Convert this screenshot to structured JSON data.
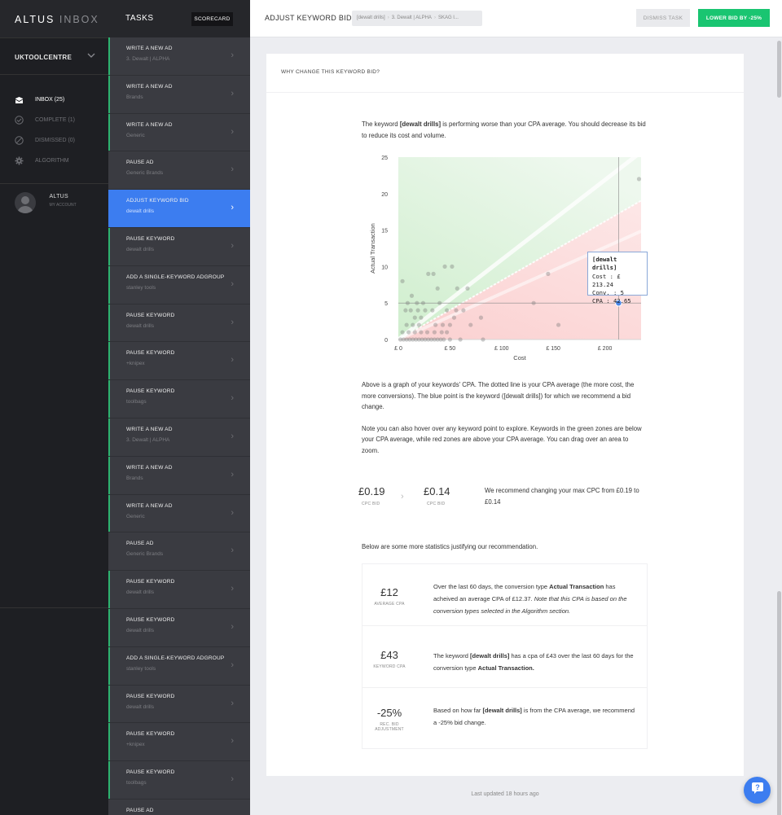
{
  "nav": {
    "logo_bold": "ALTUS",
    "logo_light": " INBOX",
    "account": "UKTOOLCENTRE",
    "menu": [
      {
        "label": "INBOX (25)",
        "icon": "inbox-icon",
        "active": true
      },
      {
        "label": "COMPLETE (1)",
        "icon": "check-circle-icon",
        "active": false
      },
      {
        "label": "DISMISSED (0)",
        "icon": "ban-icon",
        "active": false
      },
      {
        "label": "ALGORITHM",
        "icon": "gear-icon",
        "active": false
      }
    ],
    "user": {
      "name": "ALTUS",
      "sub": "MY ACCOUNT"
    }
  },
  "tasks_panel": {
    "title": "TASKS",
    "scorecard_label": "SCORECARD",
    "items": [
      {
        "title": "WRITE A NEW AD",
        "sub": "3. Dewalt | ALPHA",
        "accent": true
      },
      {
        "title": "WRITE A NEW AD",
        "sub": "Brands",
        "accent": true
      },
      {
        "title": "WRITE A NEW AD",
        "sub": "Generic",
        "accent": true
      },
      {
        "title": "PAUSE AD",
        "sub": "Generic Brands",
        "accent": false
      },
      {
        "title": "ADJUST KEYWORD BID",
        "sub": "dewalt drills",
        "accent": false,
        "active": true
      },
      {
        "title": "PAUSE KEYWORD",
        "sub": "dewalt drills",
        "accent": true
      },
      {
        "title": "ADD A SINGLE-KEYWORD ADGROUP",
        "sub": "stanley tools",
        "accent": true
      },
      {
        "title": "PAUSE KEYWORD",
        "sub": "dewalt drills",
        "accent": true
      },
      {
        "title": "PAUSE KEYWORD",
        "sub": "+knipex",
        "accent": true
      },
      {
        "title": "PAUSE KEYWORD",
        "sub": "toolbags",
        "accent": true
      },
      {
        "title": "WRITE A NEW AD",
        "sub": "3. Dewalt | ALPHA",
        "accent": true
      },
      {
        "title": "WRITE A NEW AD",
        "sub": "Brands",
        "accent": true
      },
      {
        "title": "WRITE A NEW AD",
        "sub": "Generic",
        "accent": true
      },
      {
        "title": "PAUSE AD",
        "sub": "Generic Brands",
        "accent": false
      },
      {
        "title": "PAUSE KEYWORD",
        "sub": "dewalt drills",
        "accent": true
      },
      {
        "title": "PAUSE KEYWORD",
        "sub": "dewalt drills",
        "accent": true
      },
      {
        "title": "ADD A SINGLE-KEYWORD ADGROUP",
        "sub": "stanley tools",
        "accent": true
      },
      {
        "title": "PAUSE KEYWORD",
        "sub": "dewalt drills",
        "accent": true
      },
      {
        "title": "PAUSE KEYWORD",
        "sub": "+knipex",
        "accent": true
      },
      {
        "title": "PAUSE KEYWORD",
        "sub": "toolbags",
        "accent": true
      },
      {
        "title": "PAUSE AD",
        "sub": "",
        "accent": false
      }
    ]
  },
  "header": {
    "title": "ADJUST KEYWORD BID",
    "breadcrumb": [
      "[dewalt drills]",
      "3. Dewalt | ALPHA",
      "SKAG I..."
    ],
    "dismiss_label": "DISMISS TASK",
    "action_label": "LOWER BID BY -25%"
  },
  "panel": {
    "heading": "WHY CHANGE THIS KEYWORD BID?",
    "intro_1": "The keyword ",
    "intro_keyword": "[dewalt drills]",
    "intro_2": " is performing worse than your CPA average. You should decrease its bid to reduce its cost and volume.",
    "explain_1": "Above is a graph of your keywords' CPA. The dotted line is your CPA average (the more cost, the more conversions). The blue point is the keyword ([dewalt drills]) for which we recommend a bid change.",
    "explain_2": "Note you can also hover over any keyword point to explore. Keywords in the green zones are below your CPA average, while red zones are above your CPA average. You can drag over an area to zoom.",
    "bid": {
      "current": "£0.19",
      "current_label": "CPC BID",
      "new": "£0.14",
      "new_label": "CPC BID",
      "text": "We recommend changing your max CPC from £0.19 to £0.14"
    },
    "stats_intro": "Below are some more statistics justifying our recommendation.",
    "stats": [
      {
        "value": "£12",
        "label": "AVERAGE CPA",
        "t1": "Over the last 60 days, the conversion type ",
        "t2": "Actual Transaction",
        "t3": " has acheived an average CPA of £12.37. ",
        "t4": "Note that this CPA is based on the conversion types selected in the Algorithm section."
      },
      {
        "value": "£43",
        "label": "KEYWORD CPA",
        "t1": "The keyword ",
        "t2": "[dewalt drills]",
        "t3": " has a cpa of £43 over the last 60 days for the conversion type ",
        "t4": "Actual Transaction."
      },
      {
        "value": "-25%",
        "label": "REC. BID ADJUSTMENT",
        "t1": "Based on how far ",
        "t2": "[dewalt drills]",
        "t3": " is from the CPA average, we recommend a -25% bid change.",
        "t4": ""
      }
    ]
  },
  "footer": {
    "updated": "Last updated 18 hours ago"
  },
  "colors": {
    "accent_green": "#19c571",
    "active_blue": "#3c7df0",
    "highlight_point": "#4a86e8"
  },
  "chart_data": {
    "type": "scatter",
    "xlabel": "Cost",
    "ylabel": "Actual Transaction",
    "xlim": [
      0,
      235
    ],
    "ylim": [
      0,
      25
    ],
    "x_ticks": [
      "£ 0",
      "£ 50",
      "£ 100",
      "£ 150",
      "£ 200"
    ],
    "y_ticks": [
      "0",
      "5",
      "10",
      "15",
      "20",
      "25"
    ],
    "cpa_average_line_slope_per_pound": 0.081,
    "highlight": {
      "name": "[dewalt drills]",
      "cost": 213.24,
      "conv": 5,
      "cpa": 42.65
    },
    "tooltip": [
      "[dewalt drills]",
      "Cost : £ 213.24",
      "Conv. : 5",
      "CPA : 42.65"
    ],
    "points": [
      [
        4,
        8
      ],
      [
        9,
        5
      ],
      [
        13,
        6
      ],
      [
        18,
        5
      ],
      [
        24,
        5
      ],
      [
        29,
        9
      ],
      [
        34,
        9
      ],
      [
        45,
        10
      ],
      [
        52,
        10
      ],
      [
        38,
        7
      ],
      [
        57,
        7
      ],
      [
        67,
        7
      ],
      [
        40,
        5
      ],
      [
        47,
        4
      ],
      [
        56,
        4
      ],
      [
        63,
        4
      ],
      [
        54,
        3
      ],
      [
        80,
        3
      ],
      [
        33,
        4
      ],
      [
        26,
        4
      ],
      [
        19,
        4
      ],
      [
        12,
        4
      ],
      [
        7,
        4
      ],
      [
        36,
        2
      ],
      [
        43,
        2
      ],
      [
        50,
        2
      ],
      [
        70,
        2
      ],
      [
        22,
        3
      ],
      [
        16,
        3
      ],
      [
        8,
        2
      ],
      [
        14,
        2
      ],
      [
        20,
        2
      ],
      [
        28,
        1
      ],
      [
        35,
        1
      ],
      [
        42,
        1
      ],
      [
        47,
        1
      ],
      [
        82,
        0
      ],
      [
        4,
        1
      ],
      [
        10,
        1
      ],
      [
        16,
        1
      ],
      [
        22,
        1
      ],
      [
        2,
        0
      ],
      [
        5,
        0
      ],
      [
        8,
        0
      ],
      [
        11,
        0
      ],
      [
        14,
        0
      ],
      [
        17,
        0
      ],
      [
        20,
        0
      ],
      [
        23,
        0
      ],
      [
        26,
        0
      ],
      [
        29,
        0
      ],
      [
        32,
        0
      ],
      [
        35,
        0
      ],
      [
        38,
        0
      ],
      [
        41,
        0
      ],
      [
        44,
        0
      ],
      [
        50,
        0
      ],
      [
        60,
        0
      ],
      [
        131,
        5
      ],
      [
        145,
        9
      ],
      [
        155,
        2
      ],
      [
        233,
        22
      ]
    ]
  }
}
